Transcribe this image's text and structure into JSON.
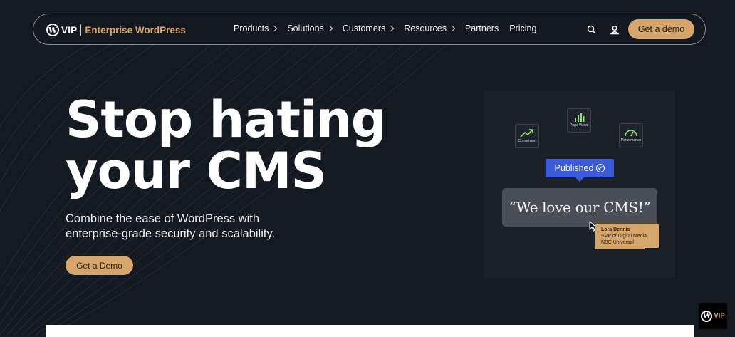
{
  "header": {
    "logo_mark": "W",
    "logo_vip": "VIP",
    "logo_brand": "Enterprise WordPress",
    "menu": [
      {
        "label": "Products",
        "has_chevron": true
      },
      {
        "label": "Solutions",
        "has_chevron": true
      },
      {
        "label": "Customers",
        "has_chevron": true
      },
      {
        "label": "Resources",
        "has_chevron": true
      },
      {
        "label": "Partners",
        "has_chevron": false
      },
      {
        "label": "Pricing",
        "has_chevron": false
      }
    ],
    "icons": [
      "search-icon",
      "user-icon"
    ],
    "cta_label": "Get a demo"
  },
  "hero": {
    "title": "Stop hating\nyour CMS",
    "subtitle": "Combine the ease of WordPress with enterprise-grade security and scalability.",
    "cta_label": "Get a Demo"
  },
  "illustration": {
    "metrics": [
      {
        "label": "Conversion",
        "icon": "trend-up-icon"
      },
      {
        "label": "Page Views",
        "icon": "bar-chart-icon"
      },
      {
        "label": "Performance",
        "icon": "gauge-icon"
      }
    ],
    "published_label": "Published",
    "quote": "“We love our CMS!”",
    "author": {
      "name": "Lora Dennis",
      "title": "SVP of Digital Media",
      "company": "NBC Universal"
    }
  },
  "corner_badge": {
    "mark": "W",
    "label": "VIP"
  },
  "colors": {
    "background": "#151a22",
    "accent": "#d6a56b",
    "published_blue": "#3b5bdb",
    "quote_bubble": "#4a4e56"
  }
}
